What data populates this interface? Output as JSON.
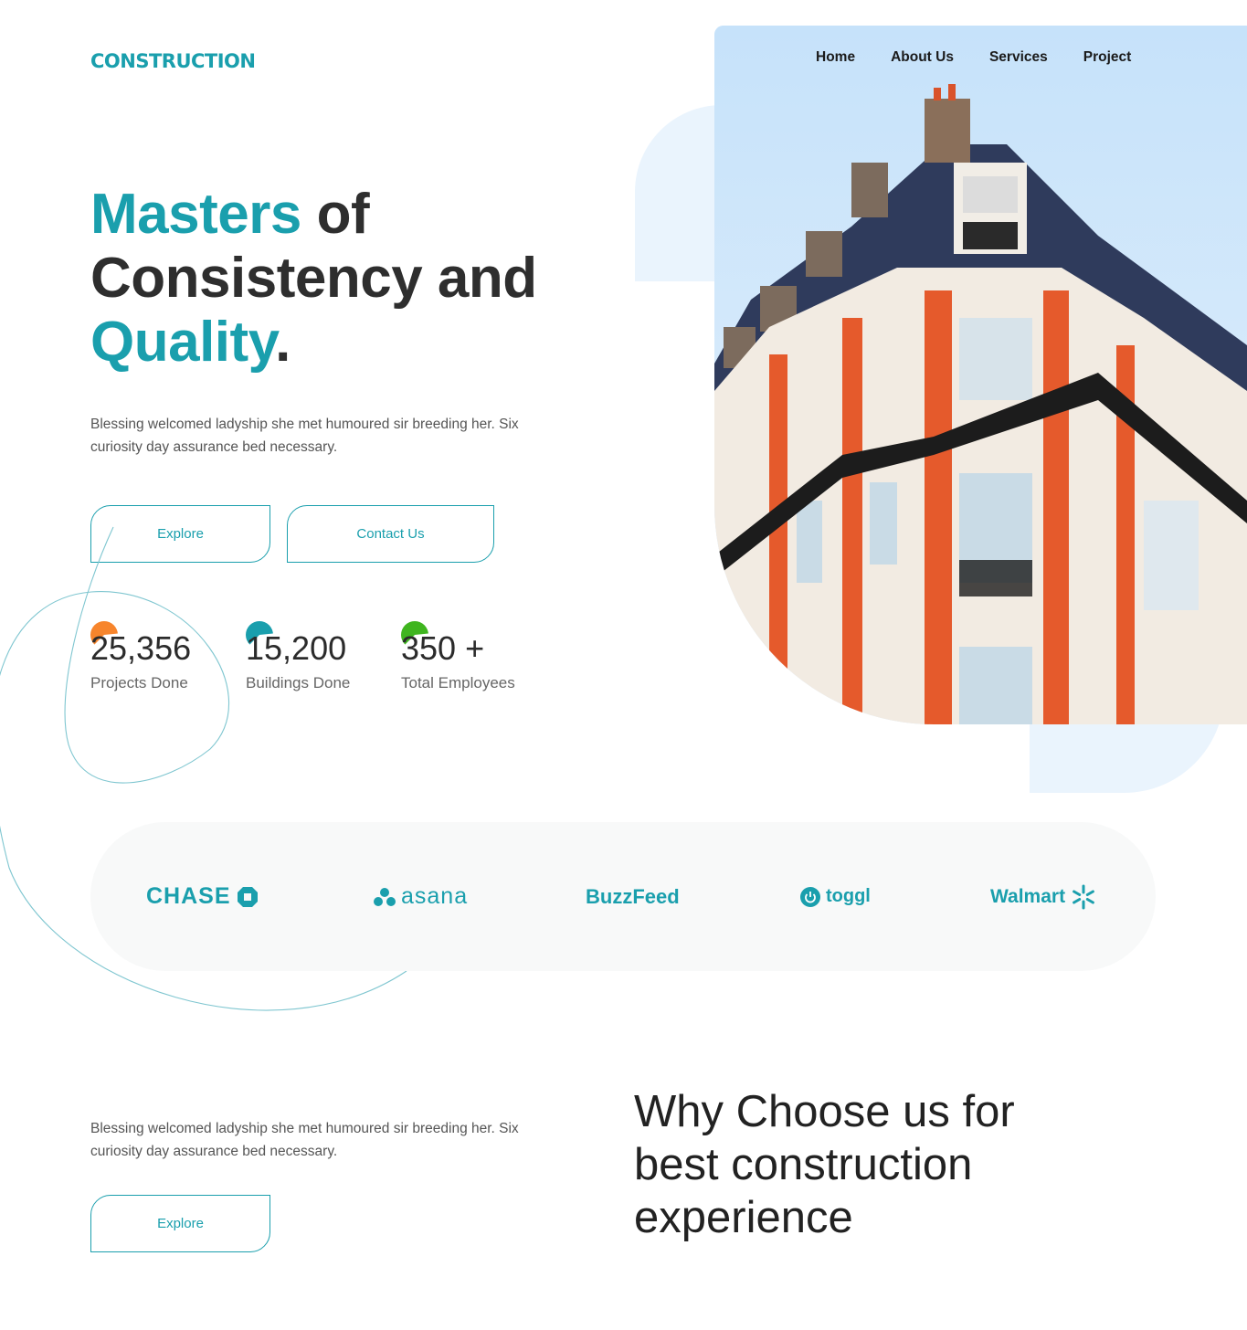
{
  "brand": {
    "logo": "CONSTRUCTION"
  },
  "nav": {
    "items": [
      "Home",
      "About Us",
      "Services",
      "Project"
    ]
  },
  "hero": {
    "headline": {
      "accent_1": "Masters",
      "part_1": " of",
      "part_2": "Consistency and",
      "accent_2": "Quality",
      "part_3": "."
    },
    "description": "Blessing welcomed ladyship she met humoured sir breeding her. Six curiosity day assurance bed necessary.",
    "buttons": {
      "explore": "Explore",
      "contact": "Contact Us"
    }
  },
  "stats": [
    {
      "value": "25,356",
      "label": "Projects Done",
      "color": "#f7852c"
    },
    {
      "value": "15,200",
      "label": "Buildings Done",
      "color": "#1a9fad"
    },
    {
      "value": "350 +",
      "label": "Total Employees",
      "color": "#3fb51f"
    }
  ],
  "partners": [
    "CHASE",
    "asana",
    "BuzzFeed",
    "toggl",
    "Walmart"
  ],
  "why": {
    "description": "Blessing welcomed ladyship she met humoured sir breeding her. Six curiosity day assurance bed necessary.",
    "button": "Explore",
    "title": "Why Choose us for best construction experience"
  },
  "colors": {
    "accent": "#1a9fad",
    "brand_bg": "#f8f9f9",
    "shape_bg": "#eaf4fd"
  }
}
